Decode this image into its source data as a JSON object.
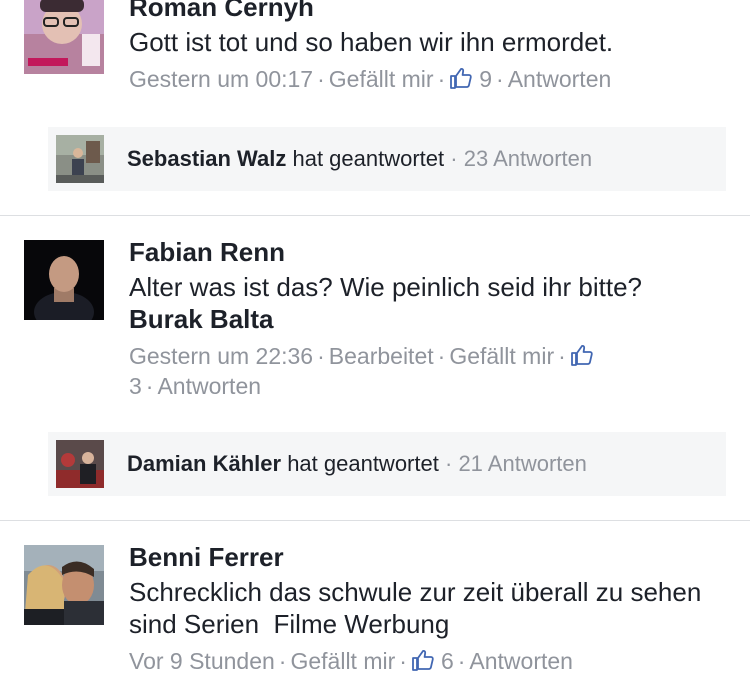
{
  "comments": [
    {
      "author": "Roman Cernyh",
      "text": "Gott ist tot und so haben wir ihn ermordet.",
      "mention": "",
      "timestamp": "Gestern um 00:17",
      "edited_label": "",
      "like_label": "Gefällt mir",
      "like_count": "9",
      "reply_label": "Antworten",
      "reply_preview": {
        "name": "Sebastian Walz",
        "action": "hat geantwortet",
        "count": "23 Antworten"
      }
    },
    {
      "author": "Fabian Renn",
      "text": "Alter was ist das? Wie peinlich seid ihr bitte?",
      "mention": "Burak Balta",
      "timestamp": "Gestern um 22:36",
      "edited_label": "Bearbeitet",
      "like_label": "Gefällt mir",
      "like_count": "3",
      "reply_label": "Antworten",
      "reply_preview": {
        "name": "Damian Kähler",
        "action": "hat geantwortet",
        "count": "21 Antworten"
      }
    },
    {
      "author": "Benni Ferrer",
      "text": "Schrecklich das schwule zur zeit überall zu sehen sind Serien  Filme Werbung",
      "mention": "",
      "timestamp": "Vor 9 Stunden",
      "edited_label": "",
      "like_label": "Gefällt mir",
      "like_count": "6",
      "reply_label": "Antworten"
    }
  ],
  "separator": "·",
  "icons": {
    "like": "thumbs-up-icon"
  },
  "colors": {
    "text": "#1d2129",
    "meta": "#90949c",
    "like_blue": "#4267b2",
    "reply_bg": "#f5f6f7",
    "divider": "#dddfe2"
  }
}
